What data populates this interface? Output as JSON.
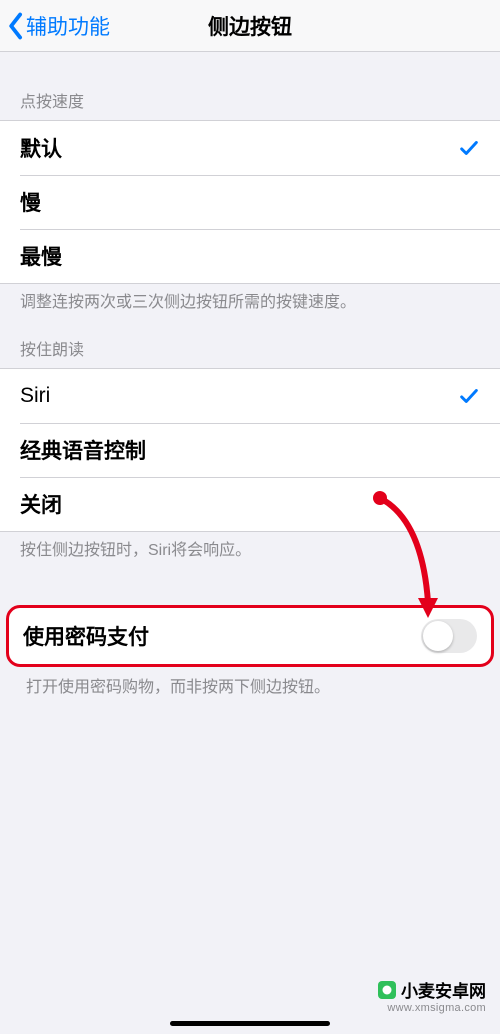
{
  "nav": {
    "back_label": "辅助功能",
    "title": "侧边按钮"
  },
  "click_speed": {
    "header": "点按速度",
    "options": {
      "default": "默认",
      "slow": "慢",
      "slowest": "最慢"
    },
    "selected": "default",
    "footer": "调整连按两次或三次侧边按钮所需的按键速度。"
  },
  "hold_speak": {
    "header": "按住朗读",
    "options": {
      "siri": "Siri",
      "classic": "经典语音控制",
      "off": "关闭"
    },
    "selected": "siri",
    "footer": "按住侧边按钮时，Siri将会响应。"
  },
  "password_pay": {
    "label": "使用密码支付",
    "state": false,
    "footer": "打开使用密码购物，而非按两下侧边按钮。"
  },
  "watermark": {
    "brand": "小麦安卓网",
    "url": "www.xmsigma.com"
  }
}
